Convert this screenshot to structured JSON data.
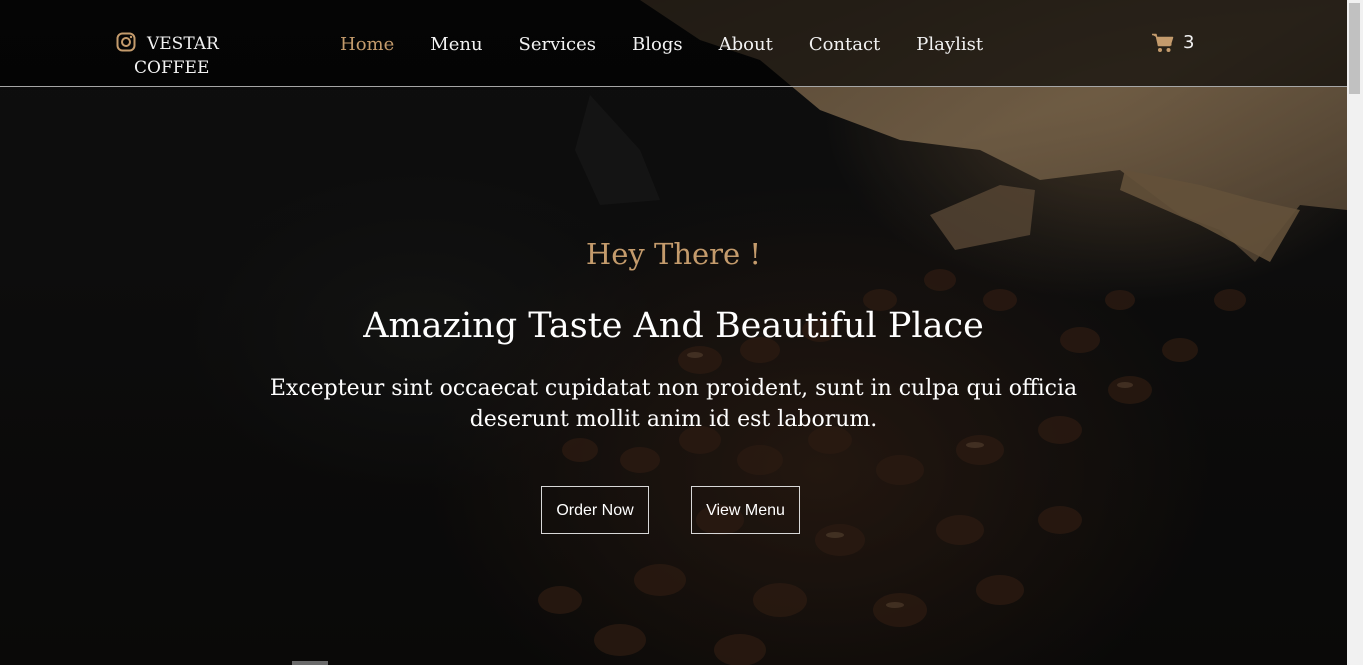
{
  "brand": {
    "icon": "instagram-icon",
    "line1": "VESTAR",
    "line2": "COFFEE"
  },
  "nav": {
    "items": [
      {
        "label": "Home",
        "active": true
      },
      {
        "label": "Menu",
        "active": false
      },
      {
        "label": "Services",
        "active": false
      },
      {
        "label": "Blogs",
        "active": false
      },
      {
        "label": "About",
        "active": false
      },
      {
        "label": "Contact",
        "active": false
      },
      {
        "label": "Playlist",
        "active": false
      }
    ]
  },
  "cart": {
    "icon": "shopping-cart-icon",
    "count": "3"
  },
  "hero": {
    "greeting": "Hey There !",
    "headline": "Amazing Taste And Beautiful Place",
    "description": "Excepteur sint occaecat cupidatat non proident, sunt in culpa qui officia deserunt mollit anim id est laborum.",
    "order_button": "Order Now",
    "menu_button": "View Menu"
  },
  "colors": {
    "accent": "#c49b6c",
    "text": "#ffffff",
    "header_bg": "rgba(0,0,0,0.62)"
  }
}
